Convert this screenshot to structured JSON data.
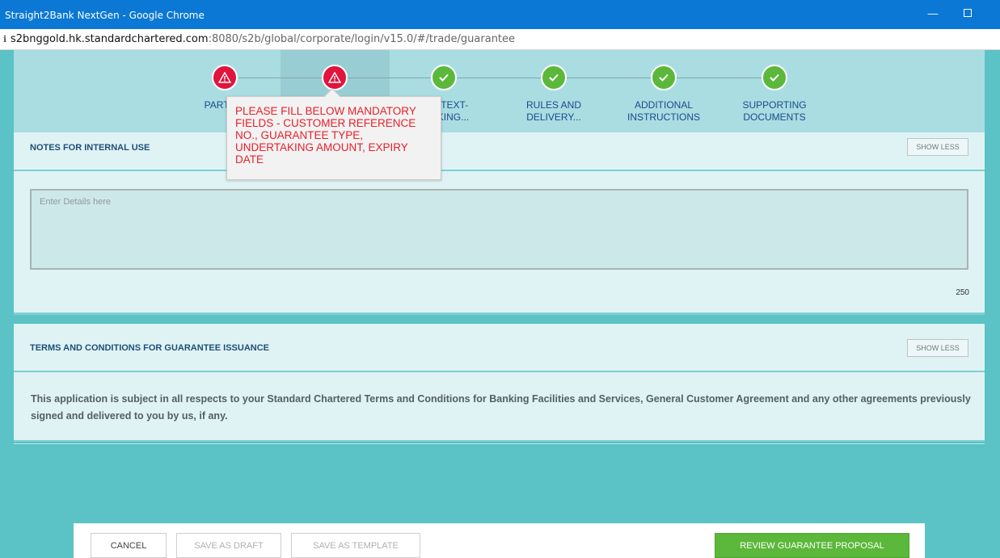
{
  "window": {
    "title": "Straight2Bank NextGen - Google Chrome",
    "minimize_glyph": "—"
  },
  "address": {
    "host": "s2bnggold.hk.standardchartered.com",
    "path": ":8080/s2b/global/corporate/login/v15.0/#/trade/guarantee"
  },
  "stepper": {
    "steps": [
      {
        "label_line1": "PARTY D",
        "label_line2": "",
        "status": "error"
      },
      {
        "label_line1": "",
        "label_line2": "",
        "status": "error"
      },
      {
        "label_line1": "TEE TEXT-",
        "label_line2": "RTAKING...",
        "status": "ok"
      },
      {
        "label_line1": "RULES AND",
        "label_line2": "DELIVERY...",
        "status": "ok"
      },
      {
        "label_line1": "ADDITIONAL",
        "label_line2": "INSTRUCTIONS",
        "status": "ok"
      },
      {
        "label_line1": "SUPPORTING",
        "label_line2": "DOCUMENTS",
        "status": "ok"
      }
    ],
    "error_color": "#e0143c",
    "ok_color": "#5bb83a"
  },
  "tooltip": {
    "message": "PLEASE FILL BELOW MANDATORY FIELDS - CUSTOMER REFERENCE NO., GUARANTEE TYPE, UNDERTAKING AMOUNT, EXPIRY DATE"
  },
  "notes": {
    "title": "NOTES FOR INTERNAL USE",
    "toggle_label": "SHOW LESS",
    "placeholder": "Enter Details here",
    "char_count": "250"
  },
  "terms": {
    "title": "TERMS AND CONDITIONS FOR GUARANTEE ISSUANCE",
    "toggle_label": "SHOW LESS",
    "text": "This application is subject in all respects to your Standard Chartered Terms and Conditions for Banking Facilities and Services, General Customer Agreement and any other agreements previously signed and delivered to you by us, if any."
  },
  "actions": {
    "cancel": "CANCEL",
    "save_draft": "SAVE AS DRAFT",
    "save_template": "SAVE AS TEMPLATE",
    "review": "REVIEW GUARANTEE PROPOSAL"
  },
  "colors": {
    "accent_green": "#5bb83a",
    "page_bg": "#5bc2c6",
    "error_text": "#e8202a"
  }
}
